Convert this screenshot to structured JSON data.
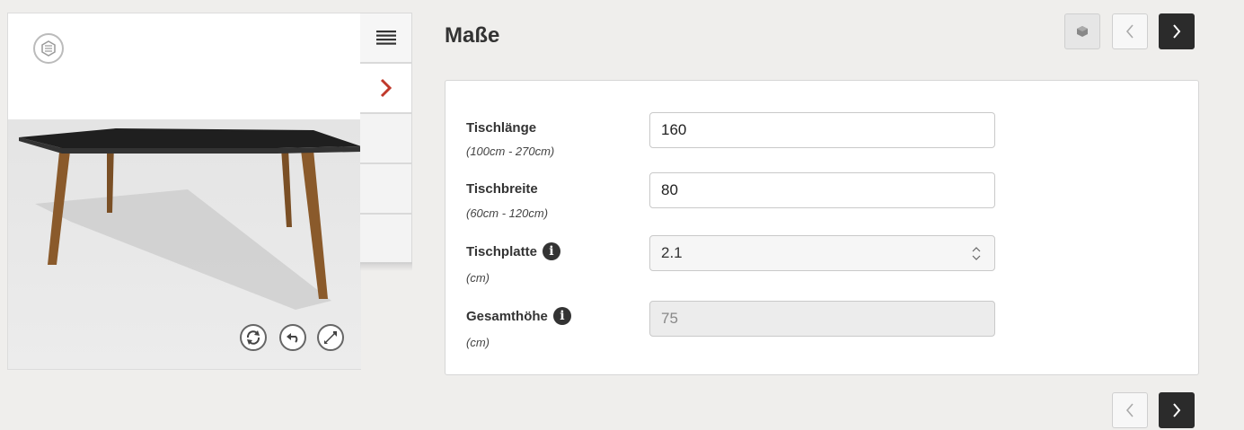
{
  "header": {
    "title": "Maße"
  },
  "sidebar": {
    "tabs": [
      {
        "name": "menu-icon"
      },
      {
        "name": "chevron-right-icon"
      },
      {
        "name": "empty"
      },
      {
        "name": "empty"
      },
      {
        "name": "empty"
      }
    ]
  },
  "viewer": {
    "controls": [
      "rotate-icon",
      "undo-icon",
      "fullscreen-icon"
    ]
  },
  "form": {
    "fields": [
      {
        "label": "Tischlänge",
        "hint": "(100cm - 270cm)",
        "value": "160",
        "type": "text"
      },
      {
        "label": "Tischbreite",
        "hint": "(60cm - 120cm)",
        "value": "80",
        "type": "text"
      },
      {
        "label": "Tischplatte",
        "hint": "(cm)",
        "value": "2.1",
        "type": "select"
      },
      {
        "label": "Gesamthöhe",
        "hint": "(cm)",
        "value": "75",
        "type": "disabled"
      }
    ]
  },
  "colors": {
    "accent": "#c0392b",
    "dark_button": "#2b2b2b",
    "table_top": "#1f1f1f",
    "table_legs": "#8a5a2b"
  }
}
